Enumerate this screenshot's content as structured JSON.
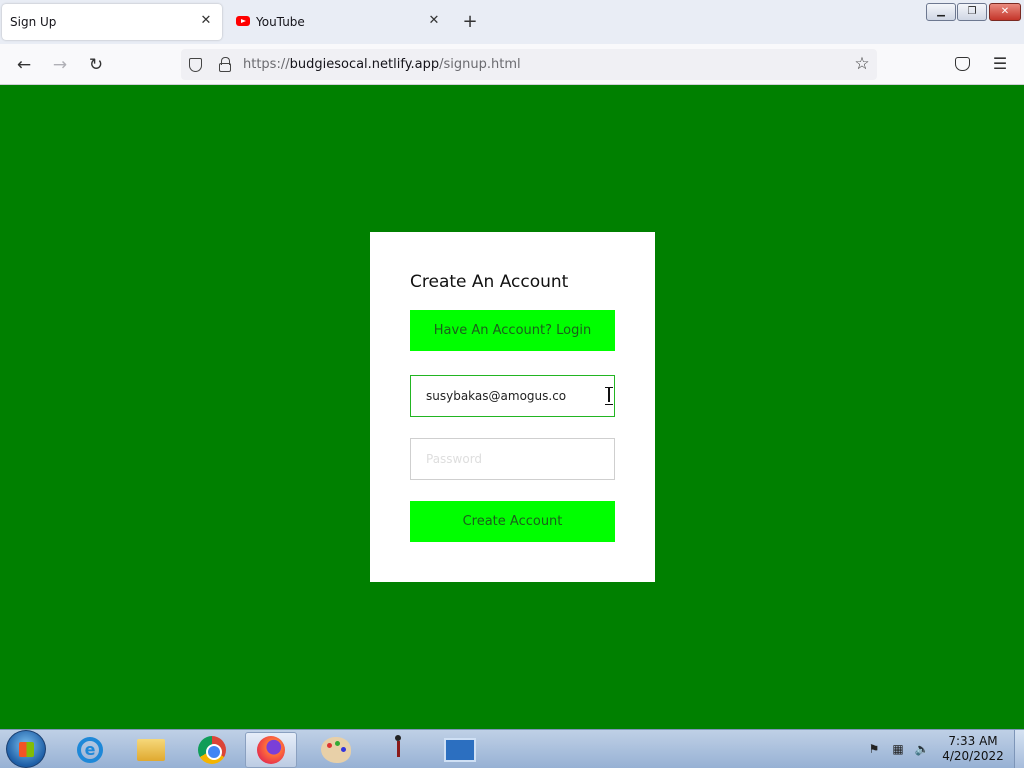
{
  "browser": {
    "tabs": [
      {
        "title": "Sign Up",
        "active": true
      },
      {
        "title": "YouTube",
        "active": false
      }
    ],
    "url": {
      "prefix": "https://",
      "host": "budgiesocal.netlify.app",
      "path": "/signup.html"
    }
  },
  "page": {
    "background_color": "#008000",
    "accent_color": "#00ff00",
    "title": "Create An Account",
    "login_button": "Have An Account? Login",
    "email_value": "susybakas@amogus.co",
    "password_placeholder": "Password",
    "create_button": "Create Account"
  },
  "taskbar": {
    "apps": [
      "internet-explorer-icon",
      "file-explorer-icon",
      "chrome-icon",
      "firefox-icon",
      "paint-icon",
      "stick-figure-icon",
      "control-panel-icon"
    ],
    "time": "7:33 AM",
    "date": "4/20/2022"
  }
}
